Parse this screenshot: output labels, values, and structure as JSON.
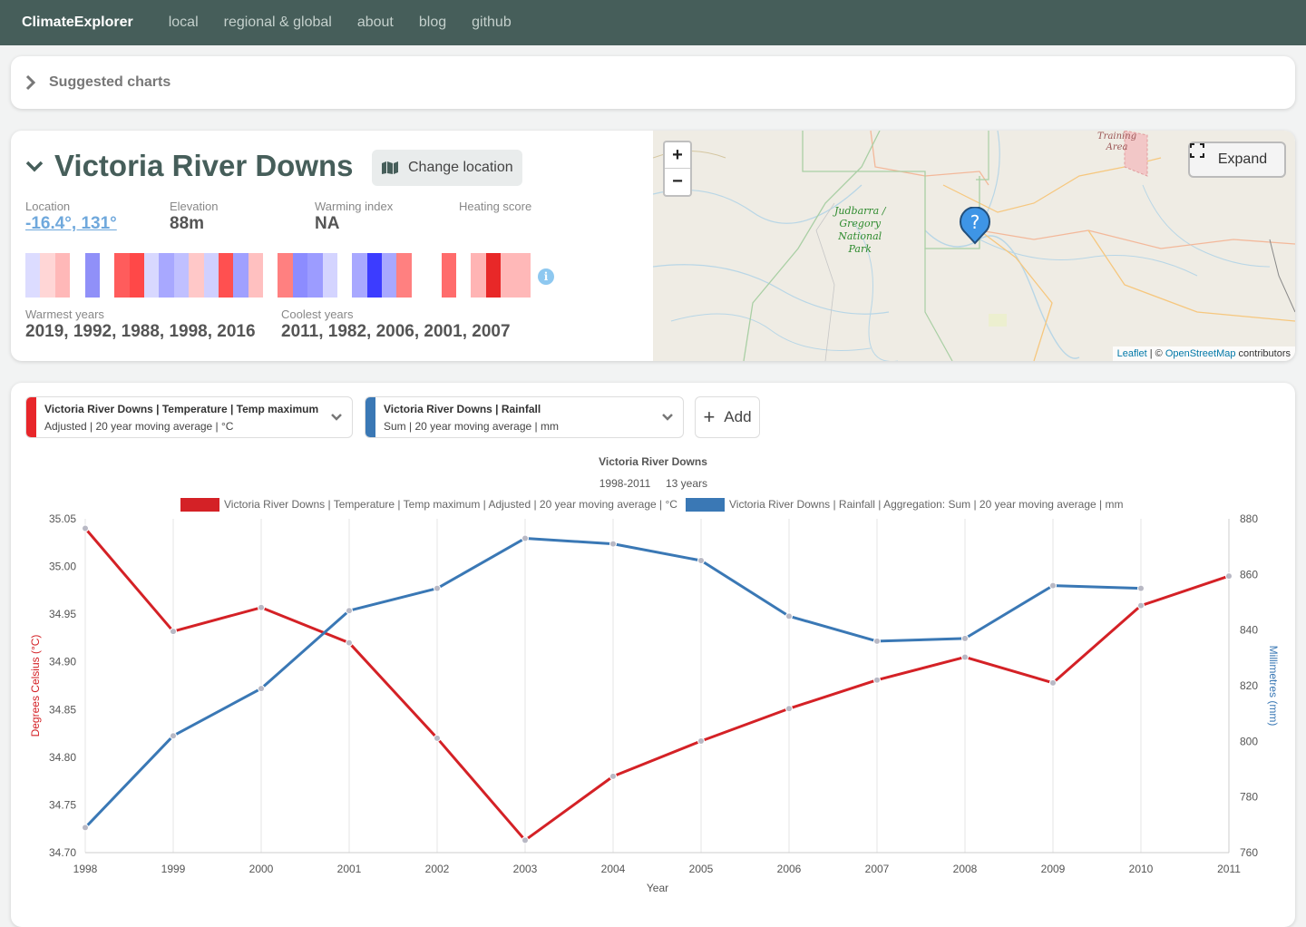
{
  "navbar": {
    "brand": "ClimateExplorer",
    "links": [
      "local",
      "regional & global",
      "about",
      "blog",
      "github"
    ]
  },
  "suggested": {
    "label": "Suggested charts"
  },
  "location": {
    "name": "Victoria River Downs",
    "change_label": "Change location",
    "stats": {
      "location_label": "Location",
      "location_value": "-16.4°, 131°",
      "elevation_label": "Elevation",
      "elevation_value": "88m",
      "warming_label": "Warming index",
      "warming_value": "NA",
      "heating_label": "Heating score",
      "heating_value": ""
    },
    "info_glyph": "i",
    "stripe_colors": [
      "#dcdcff",
      "#ffd6d6",
      "#ffb8b8",
      "#ffffff",
      "#9090f8",
      "#ffffff",
      "#ff5c5c",
      "#ff4848",
      "#d8d8ff",
      "#a8a8ff",
      "#c0c0ff",
      "#ffc8c8",
      "#d0d0ff",
      "#ff5050",
      "#a0a0ff",
      "#ffc0c0",
      "#ffffff",
      "#ff8080",
      "#8c8cff",
      "#9c9cff",
      "#d4d4ff",
      "#ffffff",
      "#a8a8ff",
      "#3c3cff",
      "#a8a8ff",
      "#ff8080",
      "#ffffff",
      "#ffffff",
      "#ff6c6c",
      "#ffffff",
      "#ffb4b4",
      "#e82828",
      "#ffb8b8",
      "#ffb8b8"
    ],
    "warmest_label": "Warmest years",
    "warmest_value": "2019, 1992, 1988, 1998, 2016",
    "coolest_label": "Coolest years",
    "coolest_value": "2011, 1982, 2006, 2001, 2007"
  },
  "map": {
    "zoom_in": "+",
    "zoom_out": "−",
    "expand_label": "Expand",
    "park_label": [
      "Judbarra /",
      "Gregory",
      "National",
      "Park"
    ],
    "training_label": [
      "Training",
      "Area"
    ],
    "marker_glyph": "?",
    "attribution": {
      "leaflet": "Leaflet",
      "sep": " | © ",
      "osm": "OpenStreetMap",
      "suffix": " contributors"
    }
  },
  "selectors": [
    {
      "line1": "Victoria River Downs | Temperature | Temp maximum",
      "line2": "Adjusted | 20 year moving average | °C",
      "color": "#e8262a"
    },
    {
      "line1": "Victoria River Downs | Rainfall",
      "line2": "Sum | 20 year moving average | mm",
      "color": "#3a78b5"
    }
  ],
  "add_label": "Add",
  "chart_data": {
    "type": "line",
    "title": "Victoria River Downs",
    "subtitle_range": "1998-2011",
    "subtitle_years": "13 years",
    "xlabel": "Year",
    "x": [
      "1998",
      "1999",
      "2000",
      "2001",
      "2002",
      "2003",
      "2004",
      "2005",
      "2006",
      "2007",
      "2008",
      "2009",
      "2010",
      "2011"
    ],
    "y_left": {
      "label": "Degrees Celsius (°C)",
      "range": [
        34.7,
        35.05
      ],
      "ticks": [
        "35.05",
        "35.00",
        "34.95",
        "34.90",
        "34.85",
        "34.80",
        "34.75",
        "34.70"
      ]
    },
    "y_right": {
      "label": "Millimetres (mm)",
      "range": [
        760,
        880
      ],
      "ticks": [
        "880",
        "860",
        "840",
        "820",
        "800",
        "780",
        "760"
      ]
    },
    "grid": true,
    "legend_position": "top",
    "series": [
      {
        "name": "Victoria River Downs | Temperature | Temp maximum | Adjusted | 20 year moving average | °C",
        "axis": "left",
        "color": "#d42126",
        "values": [
          35.04,
          34.932,
          34.957,
          34.92,
          34.82,
          34.713,
          34.78,
          34.817,
          34.851,
          34.881,
          34.905,
          34.878,
          34.959,
          34.99
        ]
      },
      {
        "name": "Victoria River Downs | Rainfall | Aggregation: Sum | 20 year moving average | mm",
        "axis": "right",
        "color": "#3a78b5",
        "values": [
          769,
          802,
          819,
          847,
          855,
          873,
          871,
          865,
          845,
          836,
          837,
          856,
          855,
          null
        ]
      }
    ]
  }
}
